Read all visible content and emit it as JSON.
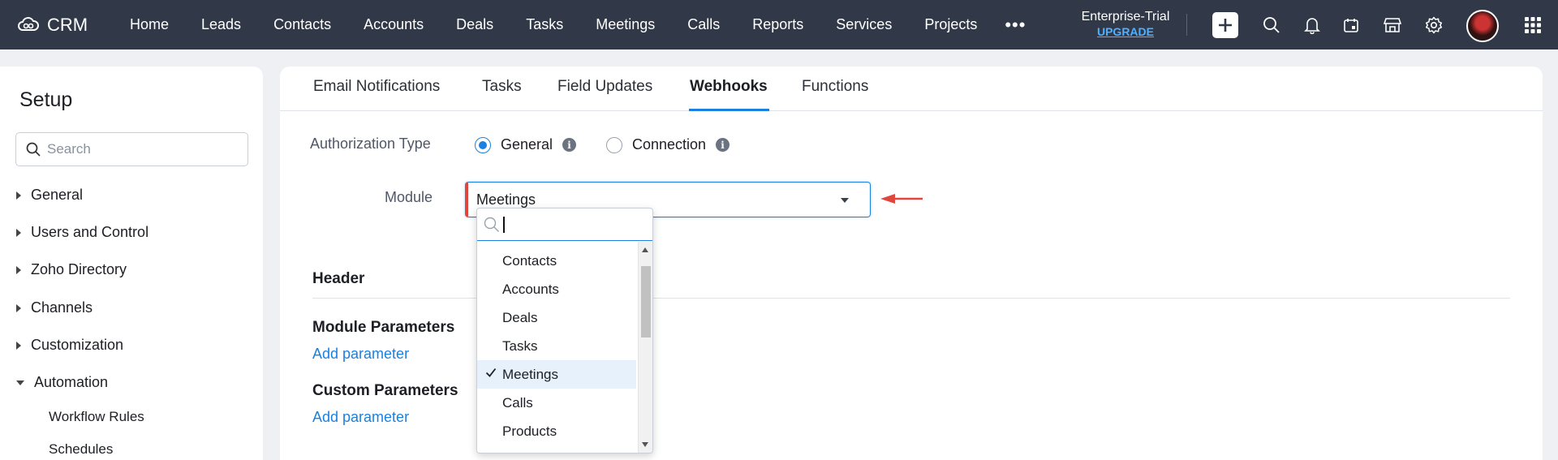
{
  "brand": {
    "name": "CRM",
    "logo_icon": "zoho-cloud-logo-icon"
  },
  "nav": {
    "items": [
      "Home",
      "Leads",
      "Contacts",
      "Accounts",
      "Deals",
      "Tasks",
      "Meetings",
      "Calls",
      "Reports",
      "Services",
      "Projects"
    ],
    "more": "•••"
  },
  "trial": {
    "label": "Enterprise-Trial",
    "upgrade": "UPGRADE"
  },
  "top_icons": [
    "plus-icon",
    "search-icon",
    "bell-icon",
    "calendar-icon",
    "marketplace-icon",
    "gear-icon",
    "avatar",
    "apps-grid-icon"
  ],
  "sidebar": {
    "title": "Setup",
    "search_placeholder": "Search",
    "items": [
      {
        "label": "General",
        "expanded": false
      },
      {
        "label": "Users and Control",
        "expanded": false
      },
      {
        "label": "Zoho Directory",
        "expanded": false
      },
      {
        "label": "Channels",
        "expanded": false
      },
      {
        "label": "Customization",
        "expanded": false
      },
      {
        "label": "Automation",
        "expanded": true
      }
    ],
    "subitems": [
      "Workflow Rules",
      "Schedules"
    ]
  },
  "tabs": [
    {
      "label": "Email Notifications",
      "active": false
    },
    {
      "label": "Tasks",
      "active": false
    },
    {
      "label": "Field Updates",
      "active": false
    },
    {
      "label": "Webhooks",
      "active": true
    },
    {
      "label": "Functions",
      "active": false
    }
  ],
  "form": {
    "auth_label": "Authorization Type",
    "auth_options": [
      {
        "label": "General",
        "checked": true
      },
      {
        "label": "Connection",
        "checked": false
      }
    ],
    "module_label": "Module",
    "module_value": "Meetings",
    "header_title": "Header",
    "module_params_title": "Module Parameters",
    "custom_params_title": "Custom Parameters",
    "add_param_label": "Add parameter"
  },
  "dropdown": {
    "search_value": "",
    "options": [
      "Contacts",
      "Accounts",
      "Deals",
      "Tasks",
      "Meetings",
      "Calls",
      "Products"
    ],
    "selected": "Meetings"
  },
  "colors": {
    "topbar": "#313949",
    "accent": "#1b80e0",
    "error_marker": "#e0463c",
    "selected_bg": "#e6f1fc"
  }
}
